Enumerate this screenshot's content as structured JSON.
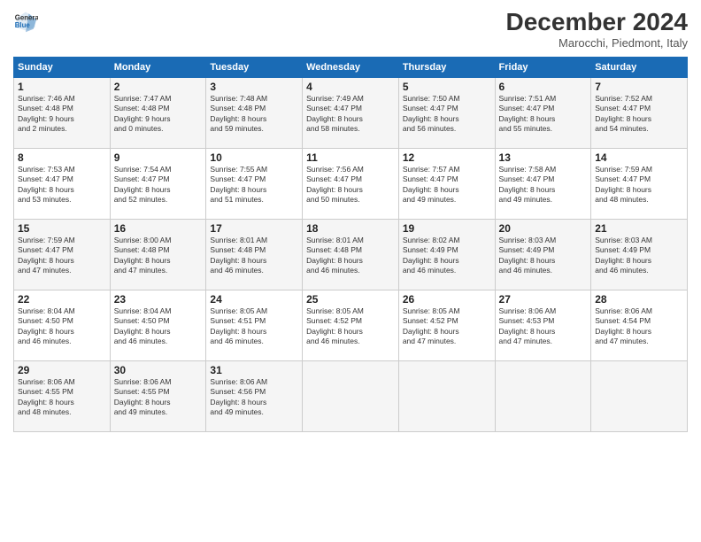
{
  "logo": {
    "line1": "General",
    "line2": "Blue"
  },
  "title": "December 2024",
  "subtitle": "Marocchi, Piedmont, Italy",
  "headers": [
    "Sunday",
    "Monday",
    "Tuesday",
    "Wednesday",
    "Thursday",
    "Friday",
    "Saturday"
  ],
  "weeks": [
    [
      {
        "day": "1",
        "info": "Sunrise: 7:46 AM\nSunset: 4:48 PM\nDaylight: 9 hours\nand 2 minutes."
      },
      {
        "day": "2",
        "info": "Sunrise: 7:47 AM\nSunset: 4:48 PM\nDaylight: 9 hours\nand 0 minutes."
      },
      {
        "day": "3",
        "info": "Sunrise: 7:48 AM\nSunset: 4:48 PM\nDaylight: 8 hours\nand 59 minutes."
      },
      {
        "day": "4",
        "info": "Sunrise: 7:49 AM\nSunset: 4:47 PM\nDaylight: 8 hours\nand 58 minutes."
      },
      {
        "day": "5",
        "info": "Sunrise: 7:50 AM\nSunset: 4:47 PM\nDaylight: 8 hours\nand 56 minutes."
      },
      {
        "day": "6",
        "info": "Sunrise: 7:51 AM\nSunset: 4:47 PM\nDaylight: 8 hours\nand 55 minutes."
      },
      {
        "day": "7",
        "info": "Sunrise: 7:52 AM\nSunset: 4:47 PM\nDaylight: 8 hours\nand 54 minutes."
      }
    ],
    [
      {
        "day": "8",
        "info": "Sunrise: 7:53 AM\nSunset: 4:47 PM\nDaylight: 8 hours\nand 53 minutes."
      },
      {
        "day": "9",
        "info": "Sunrise: 7:54 AM\nSunset: 4:47 PM\nDaylight: 8 hours\nand 52 minutes."
      },
      {
        "day": "10",
        "info": "Sunrise: 7:55 AM\nSunset: 4:47 PM\nDaylight: 8 hours\nand 51 minutes."
      },
      {
        "day": "11",
        "info": "Sunrise: 7:56 AM\nSunset: 4:47 PM\nDaylight: 8 hours\nand 50 minutes."
      },
      {
        "day": "12",
        "info": "Sunrise: 7:57 AM\nSunset: 4:47 PM\nDaylight: 8 hours\nand 49 minutes."
      },
      {
        "day": "13",
        "info": "Sunrise: 7:58 AM\nSunset: 4:47 PM\nDaylight: 8 hours\nand 49 minutes."
      },
      {
        "day": "14",
        "info": "Sunrise: 7:59 AM\nSunset: 4:47 PM\nDaylight: 8 hours\nand 48 minutes."
      }
    ],
    [
      {
        "day": "15",
        "info": "Sunrise: 7:59 AM\nSunset: 4:47 PM\nDaylight: 8 hours\nand 47 minutes."
      },
      {
        "day": "16",
        "info": "Sunrise: 8:00 AM\nSunset: 4:48 PM\nDaylight: 8 hours\nand 47 minutes."
      },
      {
        "day": "17",
        "info": "Sunrise: 8:01 AM\nSunset: 4:48 PM\nDaylight: 8 hours\nand 46 minutes."
      },
      {
        "day": "18",
        "info": "Sunrise: 8:01 AM\nSunset: 4:48 PM\nDaylight: 8 hours\nand 46 minutes."
      },
      {
        "day": "19",
        "info": "Sunrise: 8:02 AM\nSunset: 4:49 PM\nDaylight: 8 hours\nand 46 minutes."
      },
      {
        "day": "20",
        "info": "Sunrise: 8:03 AM\nSunset: 4:49 PM\nDaylight: 8 hours\nand 46 minutes."
      },
      {
        "day": "21",
        "info": "Sunrise: 8:03 AM\nSunset: 4:49 PM\nDaylight: 8 hours\nand 46 minutes."
      }
    ],
    [
      {
        "day": "22",
        "info": "Sunrise: 8:04 AM\nSunset: 4:50 PM\nDaylight: 8 hours\nand 46 minutes."
      },
      {
        "day": "23",
        "info": "Sunrise: 8:04 AM\nSunset: 4:50 PM\nDaylight: 8 hours\nand 46 minutes."
      },
      {
        "day": "24",
        "info": "Sunrise: 8:05 AM\nSunset: 4:51 PM\nDaylight: 8 hours\nand 46 minutes."
      },
      {
        "day": "25",
        "info": "Sunrise: 8:05 AM\nSunset: 4:52 PM\nDaylight: 8 hours\nand 46 minutes."
      },
      {
        "day": "26",
        "info": "Sunrise: 8:05 AM\nSunset: 4:52 PM\nDaylight: 8 hours\nand 47 minutes."
      },
      {
        "day": "27",
        "info": "Sunrise: 8:06 AM\nSunset: 4:53 PM\nDaylight: 8 hours\nand 47 minutes."
      },
      {
        "day": "28",
        "info": "Sunrise: 8:06 AM\nSunset: 4:54 PM\nDaylight: 8 hours\nand 47 minutes."
      }
    ],
    [
      {
        "day": "29",
        "info": "Sunrise: 8:06 AM\nSunset: 4:55 PM\nDaylight: 8 hours\nand 48 minutes."
      },
      {
        "day": "30",
        "info": "Sunrise: 8:06 AM\nSunset: 4:55 PM\nDaylight: 8 hours\nand 49 minutes."
      },
      {
        "day": "31",
        "info": "Sunrise: 8:06 AM\nSunset: 4:56 PM\nDaylight: 8 hours\nand 49 minutes."
      },
      {
        "day": "",
        "info": ""
      },
      {
        "day": "",
        "info": ""
      },
      {
        "day": "",
        "info": ""
      },
      {
        "day": "",
        "info": ""
      }
    ]
  ]
}
